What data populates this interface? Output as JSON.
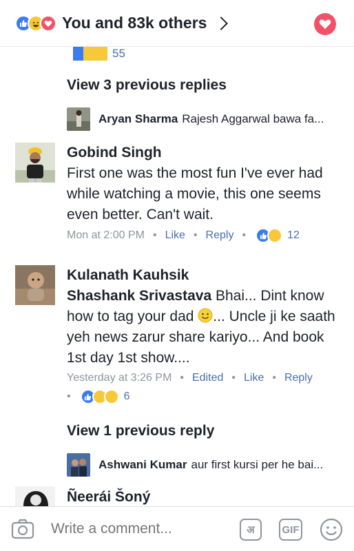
{
  "header": {
    "title": "You and 83k others",
    "reactions": [
      "like",
      "haha",
      "love"
    ]
  },
  "prev_reactions": {
    "count": "55"
  },
  "thread1": {
    "view_replies": "View 3 previous replies",
    "preview_name": "Aryan Sharma",
    "preview_text": "Rajesh Aggarwal bawa fa..."
  },
  "comments": [
    {
      "name": "Gobind Singh",
      "text": "First one was the most fun I've ever had while watching a movie, this one seems even better. Can't wait.",
      "time": "Mon at 2:00 PM",
      "like": "Like",
      "reply": "Reply",
      "reaction_count": "12"
    },
    {
      "name": "Kulanath Kauhsik",
      "tag": "Shashank Srivastava",
      "text_a": " Bhai... Dint know how to tag your dad ",
      "text_b": "... Uncle ji ke saath yeh news zarur share kariyo... And book 1st day 1st show....",
      "time": "Yesterday at 3:26 PM",
      "edited": "Edited",
      "like": "Like",
      "reply": "Reply",
      "reaction_count": "6"
    }
  ],
  "thread2": {
    "view_replies": "View 1 previous reply",
    "preview_name": "Ashwani Kumar",
    "preview_text": "aur first kursi per he bai..."
  },
  "partial_comment": {
    "name": "Ñeerái Šoný"
  },
  "composer": {
    "placeholder": "Write a comment...",
    "hindi_label": "अ",
    "gif_label": "GIF"
  },
  "colors": {
    "accent": "#4b6ea9",
    "like": "#3b7bf0",
    "love": "#f25268",
    "haha": "#f7c93a"
  }
}
